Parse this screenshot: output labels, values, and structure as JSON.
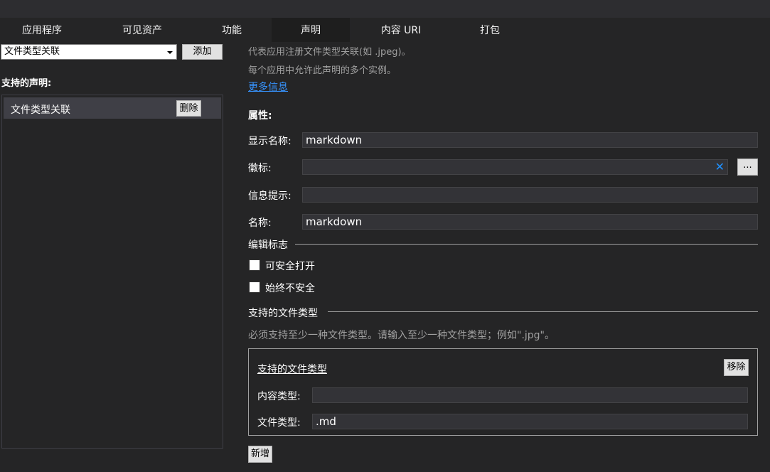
{
  "tabs": [
    {
      "label": "应用程序"
    },
    {
      "label": "可见资产"
    },
    {
      "label": "功能"
    },
    {
      "label": "声明"
    },
    {
      "label": "内容 URI"
    },
    {
      "label": "打包"
    }
  ],
  "active_tab": "声明",
  "left": {
    "declaration_select": "文件类型关联",
    "add_label": "添加",
    "supported_title": "支持的声明:",
    "declarations": [
      {
        "label": "文件类型关联",
        "delete_label": "删除"
      }
    ]
  },
  "right": {
    "description_1": "代表应用注册文件类型关联(如 .jpeg)。",
    "description_2": "每个应用中允许此声明的多个实例。",
    "more_info_link": "更多信息",
    "properties_title": "属性:",
    "display_name_label": "显示名称:",
    "display_name_value": "markdown",
    "logo_label": "徽标:",
    "logo_value": "",
    "clear_glyph": "✕",
    "browse_label": "...",
    "info_tip_label": "信息提示:",
    "info_tip_value": "",
    "name_label": "名称:",
    "name_value": "markdown",
    "edit_flags_title": "编辑标志",
    "open_is_safe_label": "可安全打开",
    "always_unsafe_label": "始终不安全",
    "supported_types_title": "支持的文件类型",
    "supported_types_hint": "必须支持至少一种文件类型。请输入至少一种文件类型；例如\".jpg\"。",
    "file_type_entry": {
      "title": "支持的文件类型",
      "remove_label": "移除",
      "content_type_label": "内容类型:",
      "content_type_value": "",
      "file_type_label": "文件类型:",
      "file_type_value": ".md"
    },
    "new_label": "新增"
  },
  "colors": {
    "background": "#252526",
    "active_tab": "#1e1e1e",
    "link": "#3794ff",
    "field_bg": "#333337",
    "clear_icon": "#1e90ff"
  }
}
